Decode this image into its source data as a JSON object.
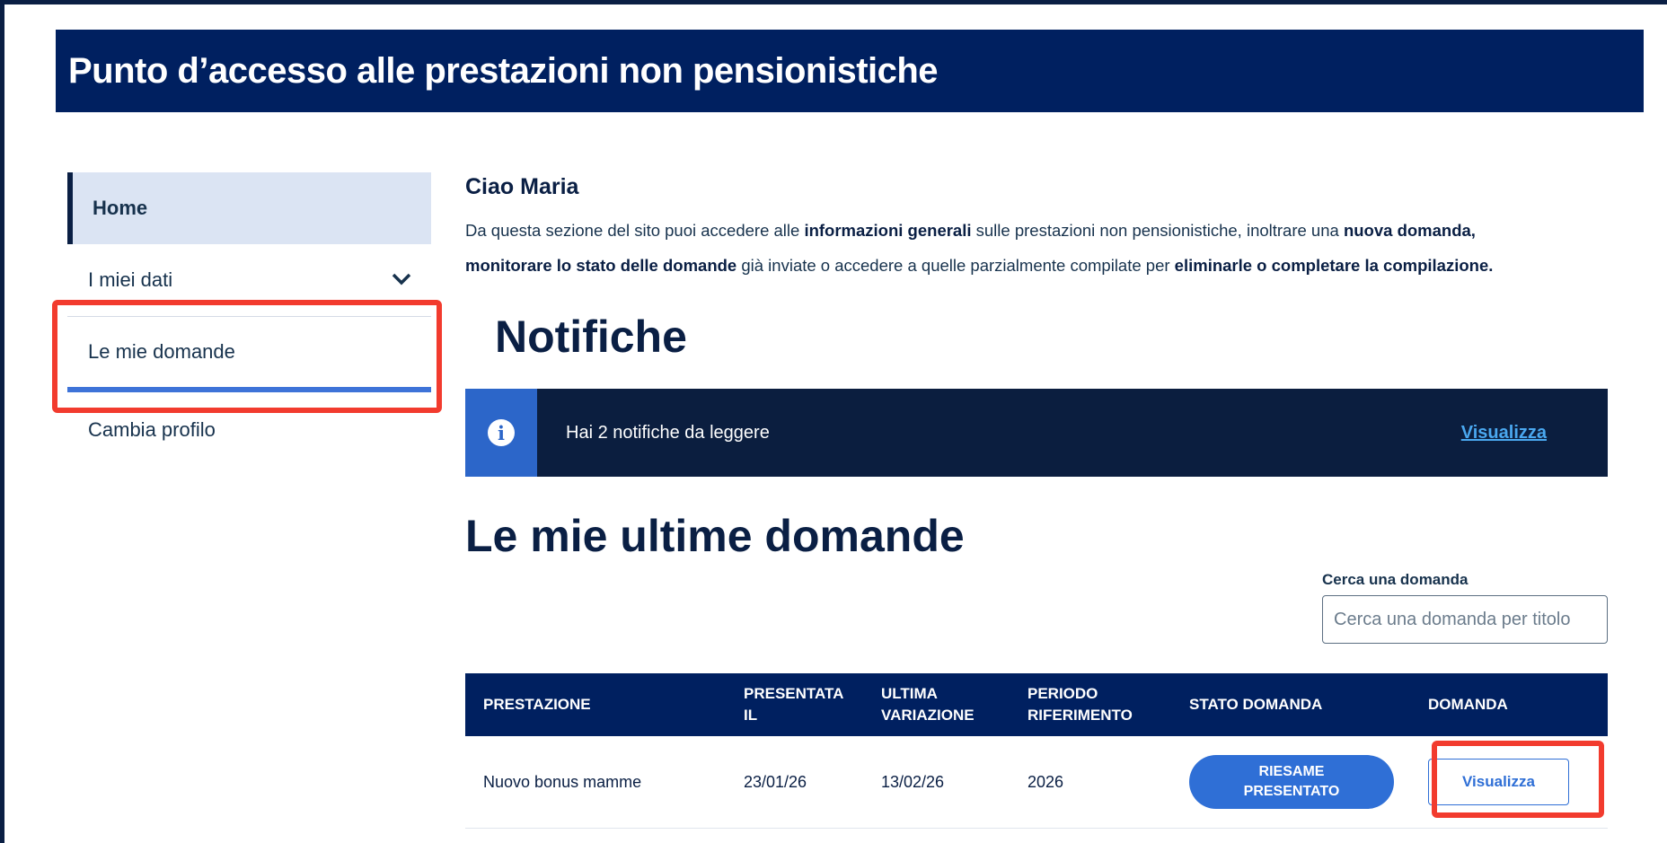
{
  "header": {
    "title": "Punto d’accesso alle prestazioni non pensionistiche"
  },
  "sidebar": {
    "items": [
      {
        "label": "Home"
      },
      {
        "label": "I miei dati"
      },
      {
        "label": "Le mie domande"
      },
      {
        "label": "Cambia profilo"
      }
    ]
  },
  "main": {
    "greeting": "Ciao Maria",
    "intro": {
      "p1": "Da questa sezione del sito puoi accedere alle ",
      "b1": "informazioni generali",
      "p2": " sulle prestazioni non pensionistiche, inoltrare una ",
      "b2": "nuova domanda,",
      "b3": "monitorare lo stato delle domande",
      "p3": " già inviate o accedere a quelle parzialmente compilate per ",
      "b4": "eliminarle o completare la compilazione."
    },
    "notifiche_title": "Notifiche",
    "notification": {
      "text": "Hai 2 notifiche da leggere",
      "link": "Visualizza"
    },
    "ultime_title": "Le mie ultime domande",
    "search": {
      "label": "Cerca una domanda",
      "placeholder": "Cerca una domanda per titolo"
    },
    "table": {
      "headers": {
        "prestazione": "PRESTAZIONE",
        "presentata_1": "PRESENTATA",
        "presentata_2": "IL",
        "ultima_1": "ULTIMA",
        "ultima_2": "VARIAZIONE",
        "periodo_1": "PERIODO",
        "periodo_2": "RIFERIMENTO",
        "stato": "STATO DOMANDA",
        "domanda": "DOMANDA"
      },
      "rows": [
        {
          "prestazione": "Nuovo bonus mamme",
          "presentata": "23/01/26",
          "ultima": "13/02/26",
          "periodo": "2026",
          "stato_1": "RIESAME",
          "stato_2": "PRESENTATO",
          "action": "Visualizza"
        }
      ]
    }
  },
  "colors": {
    "brand": "#002060",
    "accent": "#2f6fd6",
    "highlight": "#f23b2e"
  }
}
